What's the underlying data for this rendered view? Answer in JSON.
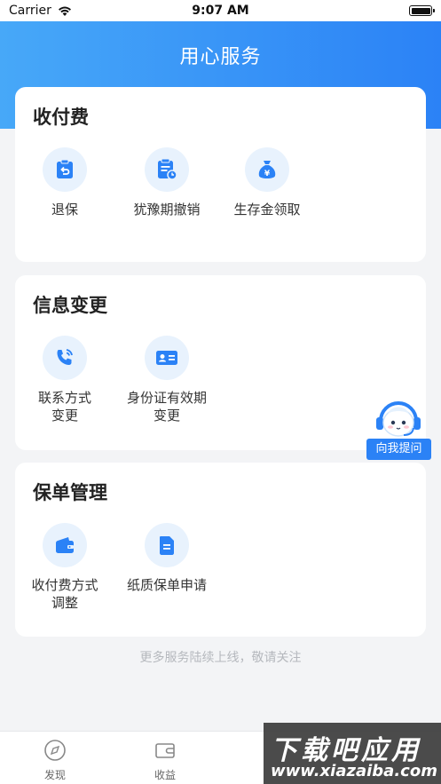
{
  "status_bar": {
    "carrier": "Carrier",
    "time": "9:07 AM"
  },
  "header": {
    "title": "用心服务"
  },
  "sections": [
    {
      "title": "收付费",
      "items": [
        {
          "label": "退保",
          "icon": "undo-clipboard-icon"
        },
        {
          "label": "犹豫期撤销",
          "icon": "clipboard-clock-icon"
        },
        {
          "label": "生存金领取",
          "icon": "money-bag-icon"
        }
      ]
    },
    {
      "title": "信息变更",
      "items": [
        {
          "label": "联系方式\n变更",
          "icon": "phone-icon"
        },
        {
          "label": "身份证有效期\n变更",
          "icon": "id-card-icon"
        }
      ]
    },
    {
      "title": "保单管理",
      "items": [
        {
          "label": "收付费方式\n调整",
          "icon": "wallet-icon"
        },
        {
          "label": "纸质保单申请",
          "icon": "document-icon"
        }
      ]
    }
  ],
  "footer_note": "更多服务陆续上线，敬请关注",
  "float_help": {
    "label": "向我提问"
  },
  "tabbar": [
    {
      "label": "发现",
      "icon": "compass-icon"
    },
    {
      "label": "收益",
      "icon": "wallet-outline-icon"
    }
  ],
  "watermark": {
    "cn": "下载吧应用",
    "en": "www.xiazaiba.com"
  },
  "colors": {
    "accent": "#2b82f6",
    "hero_start": "#47a8f8",
    "icon_bg": "#e8f2fd"
  }
}
